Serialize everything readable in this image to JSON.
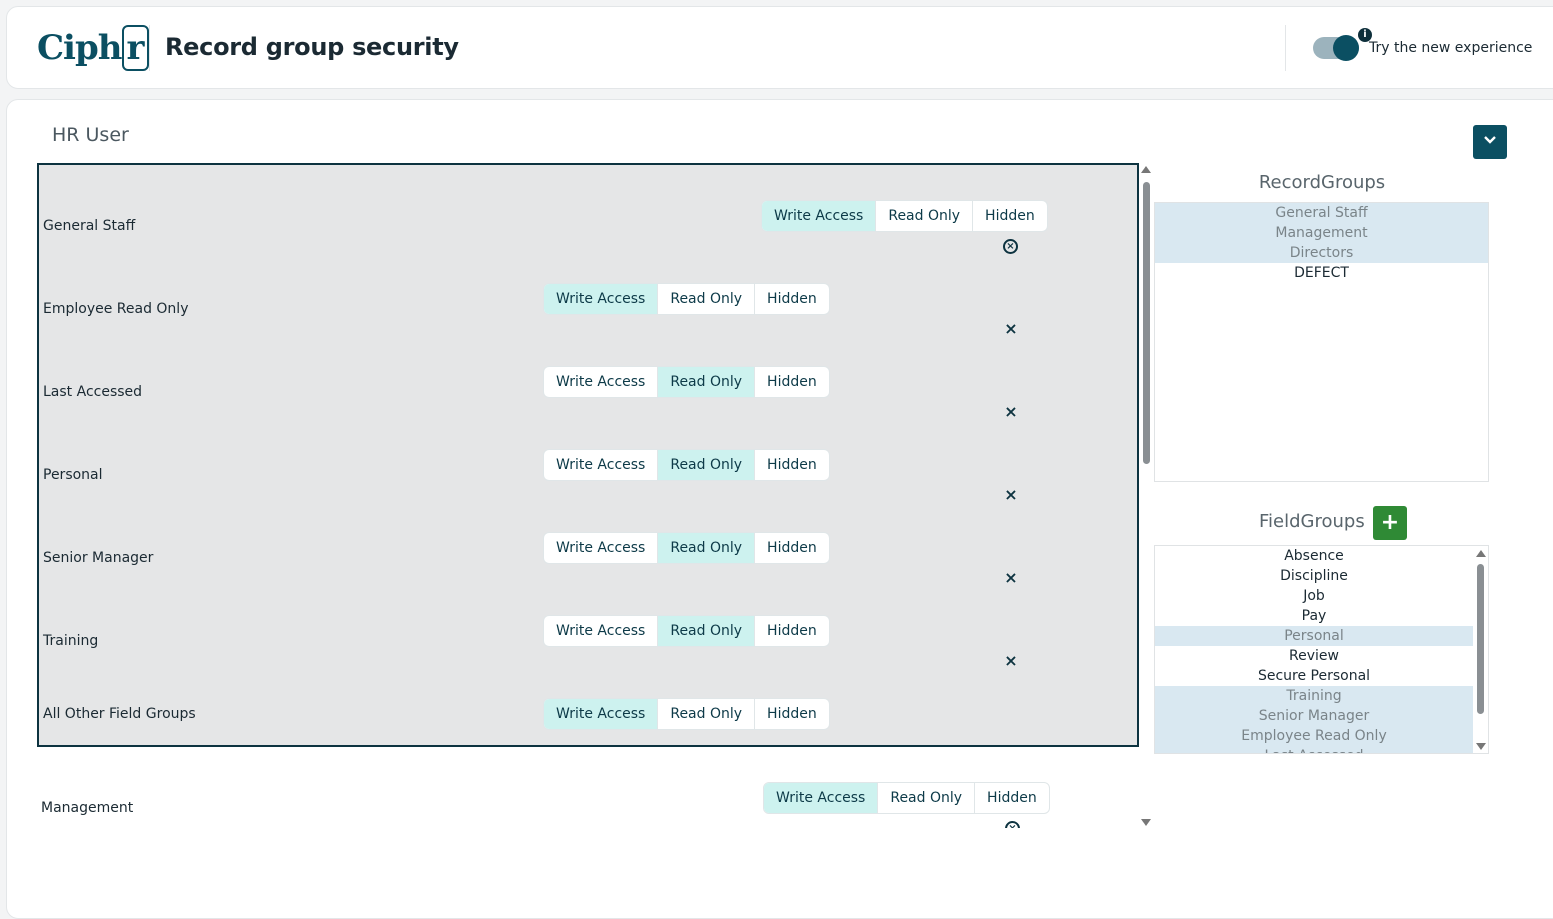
{
  "header": {
    "logo_text": "Ciph",
    "logo_box_text": "r",
    "title": "Record group security",
    "toggle_label": "Try the new experience",
    "info_glyph": "i"
  },
  "role": {
    "title": "HR User"
  },
  "segment_labels": {
    "write": "Write Access",
    "read": "Read Only",
    "hidden": "Hidden"
  },
  "field_rows": [
    {
      "label": "General Staff",
      "selected": "write"
    },
    {
      "label": "Employee Read Only",
      "selected": "write"
    },
    {
      "label": "Last Accessed",
      "selected": "read"
    },
    {
      "label": "Personal",
      "selected": "read"
    },
    {
      "label": "Senior Manager",
      "selected": "read"
    },
    {
      "label": "Training",
      "selected": "read"
    },
    {
      "label": "All Other Field Groups",
      "selected": "write"
    }
  ],
  "outer_row": {
    "label": "Management",
    "selected": "write"
  },
  "record_groups": {
    "title": "RecordGroups",
    "items": [
      {
        "label": "General Staff",
        "selected": true
      },
      {
        "label": "Management",
        "selected": true
      },
      {
        "label": "Directors",
        "selected": true
      },
      {
        "label": "DEFECT",
        "selected": false
      }
    ]
  },
  "field_groups": {
    "title": "FieldGroups",
    "add_glyph": "+",
    "items": [
      {
        "label": "Absence",
        "selected": false
      },
      {
        "label": "Discipline",
        "selected": false
      },
      {
        "label": "Job",
        "selected": false
      },
      {
        "label": "Pay",
        "selected": false
      },
      {
        "label": "Personal",
        "selected": true
      },
      {
        "label": "Review",
        "selected": false
      },
      {
        "label": "Secure Personal",
        "selected": false
      },
      {
        "label": "Training",
        "selected": true
      },
      {
        "label": "Senior Manager",
        "selected": true
      },
      {
        "label": "Employee Read Only",
        "selected": true
      },
      {
        "label": "Last Accessed",
        "selected": true
      }
    ]
  },
  "icons": {
    "remove": "×",
    "remove_circle": "×"
  },
  "colors": {
    "brand": "#0b4f62",
    "active_segment": "#cdf2ef",
    "add_button": "#2f8a35",
    "selected_list": "#d9e8f1"
  }
}
